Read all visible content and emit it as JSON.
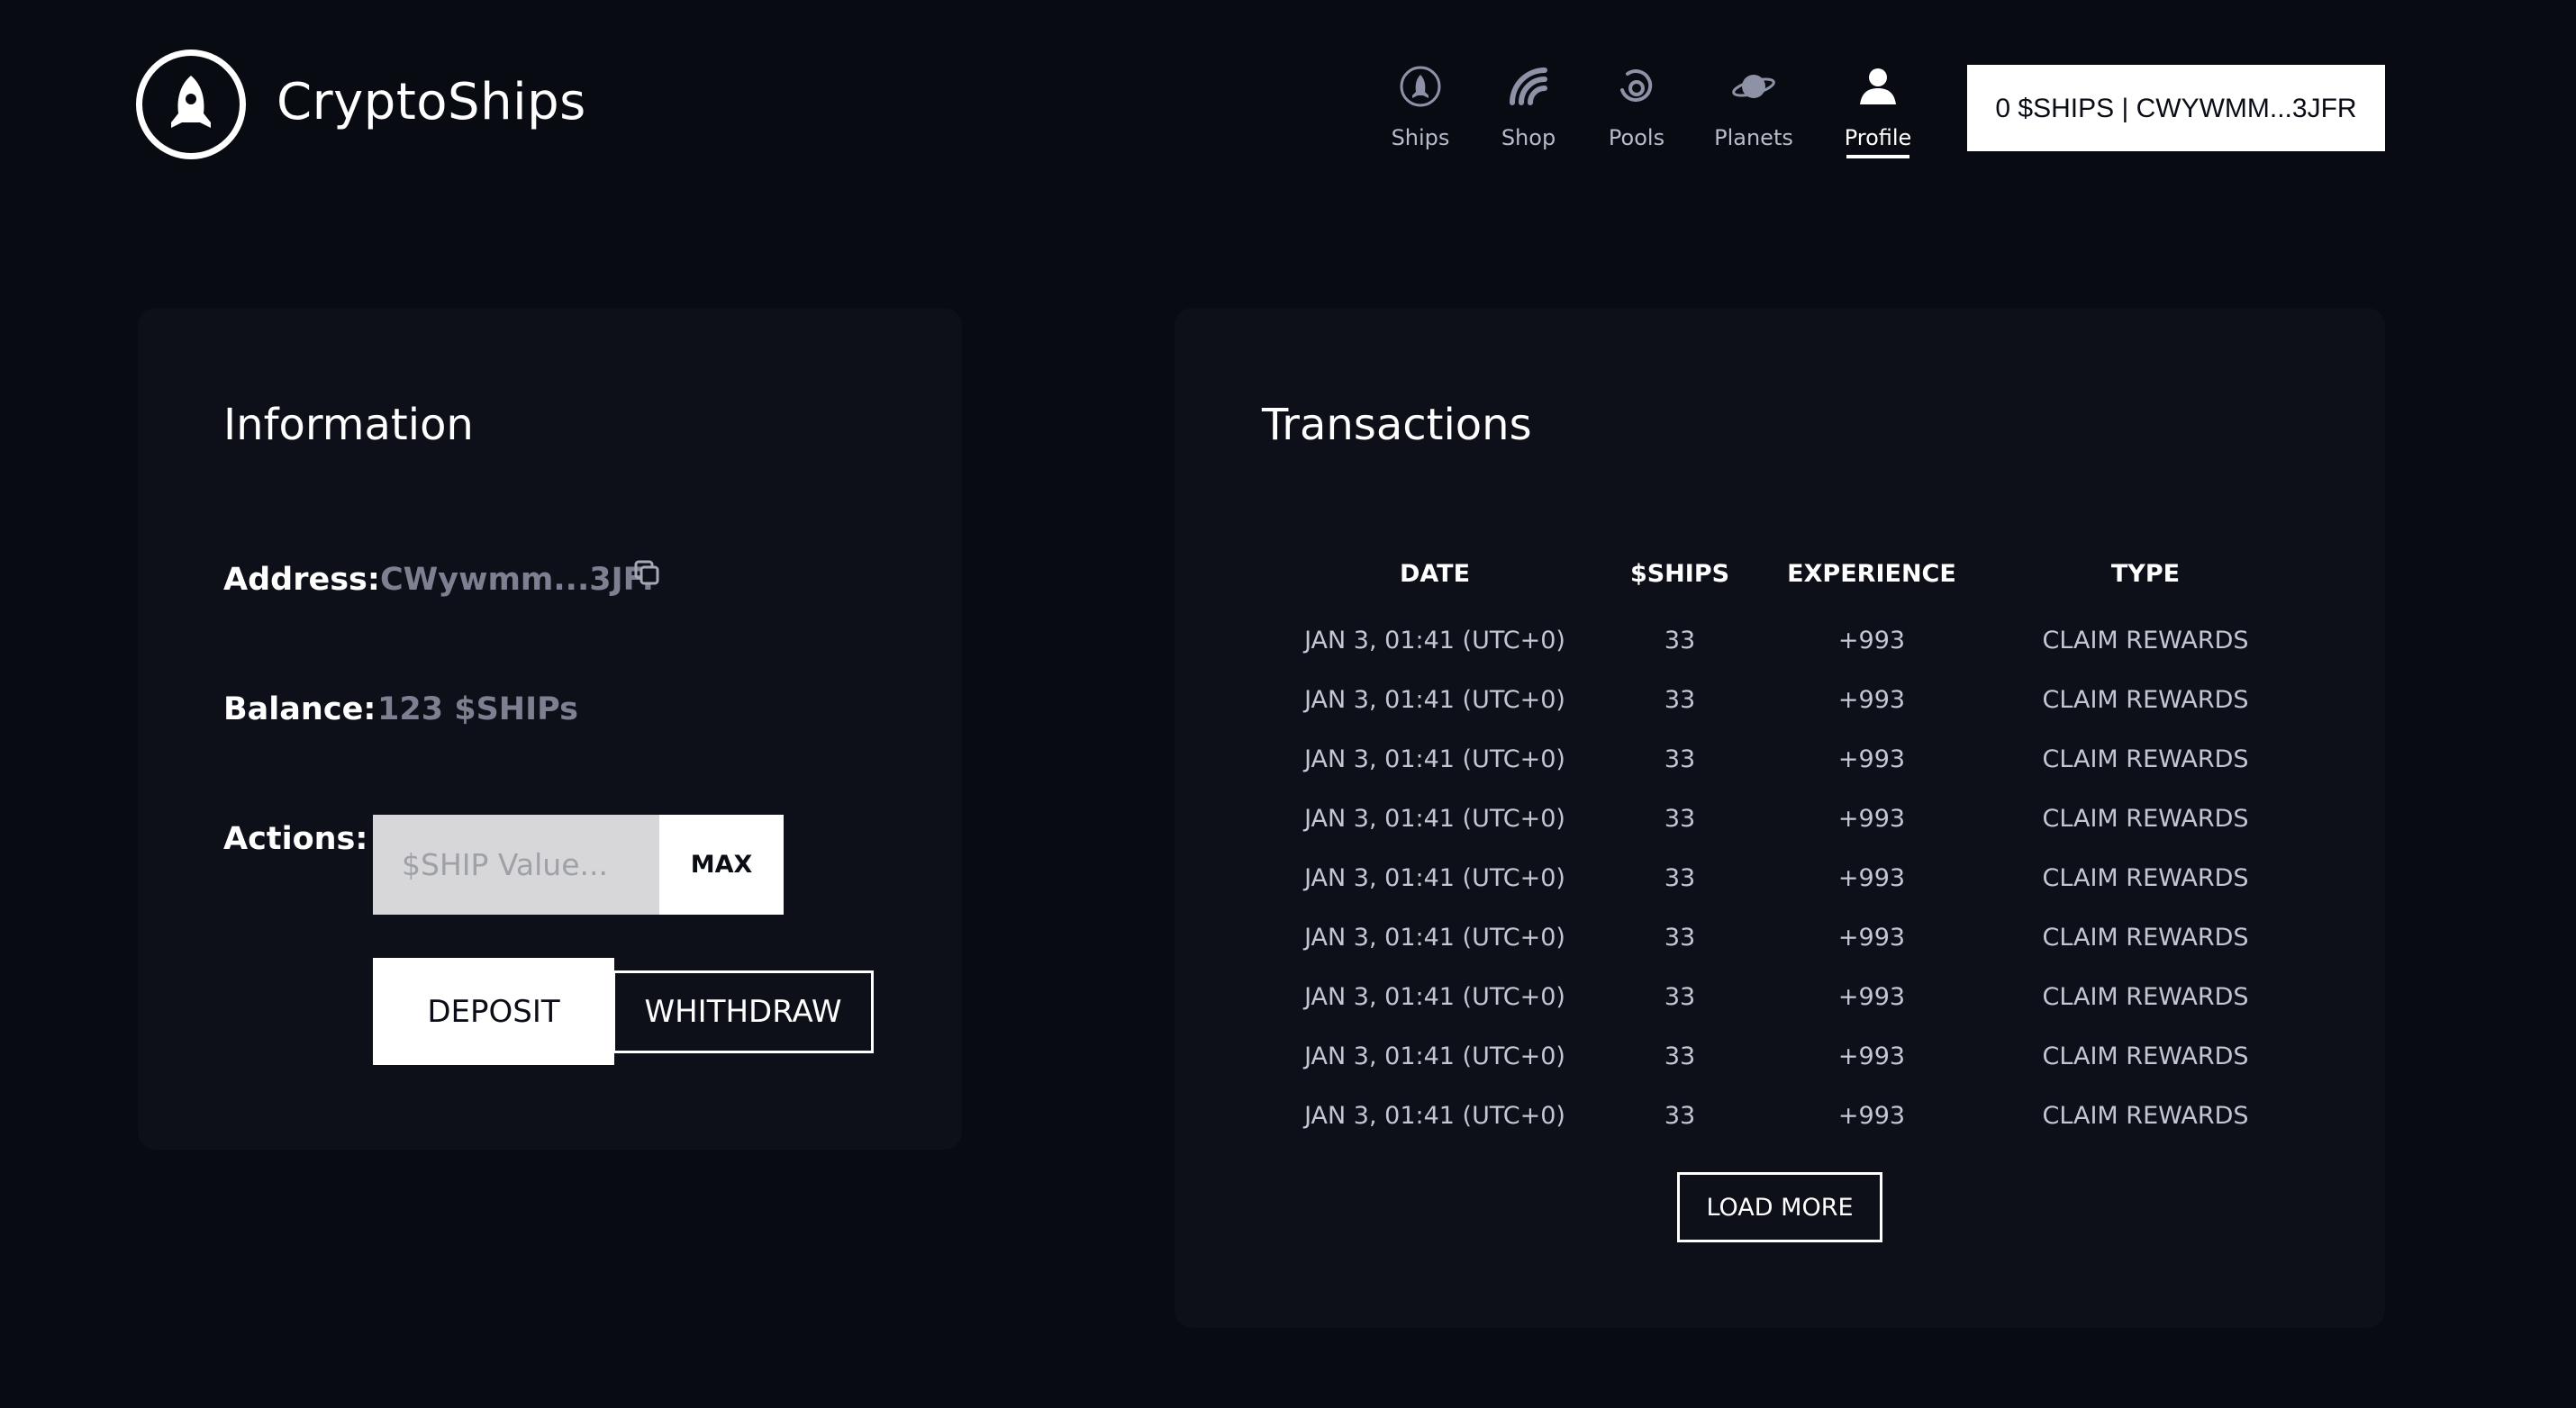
{
  "header": {
    "brand": "CryptoShips",
    "nav": [
      {
        "label": "Ships",
        "icon": "rocket-circle-icon"
      },
      {
        "label": "Shop",
        "icon": "signal-icon"
      },
      {
        "label": "Pools",
        "icon": "pool-icon"
      },
      {
        "label": "Planets",
        "icon": "planet-icon"
      },
      {
        "label": "Profile",
        "icon": "user-icon",
        "active": true
      }
    ],
    "wallet_label": "0 $SHIPS | CWYWMM...3JFR"
  },
  "info": {
    "title": "Information",
    "address_label": "Address:",
    "address_value": "CWywmm...3JFr",
    "balance_label": "Balance:",
    "balance_value": "123 $SHIPs",
    "actions_label": "Actions:",
    "input_placeholder": "$SHIP Value...",
    "max_label": "MAX",
    "deposit_label": "DEPOSIT",
    "withdraw_label": "WHITHDRAW"
  },
  "transactions": {
    "title": "Transactions",
    "columns": [
      "DATE",
      "$SHIPS",
      "EXPERIENCE",
      "TYPE"
    ],
    "rows": [
      [
        "JAN 3, 01:41 (UTC+0)",
        "33",
        "+993",
        "CLAIM REWARDS"
      ],
      [
        "JAN 3, 01:41 (UTC+0)",
        "33",
        "+993",
        "CLAIM REWARDS"
      ],
      [
        "JAN 3, 01:41 (UTC+0)",
        "33",
        "+993",
        "CLAIM REWARDS"
      ],
      [
        "JAN 3, 01:41 (UTC+0)",
        "33",
        "+993",
        "CLAIM REWARDS"
      ],
      [
        "JAN 3, 01:41 (UTC+0)",
        "33",
        "+993",
        "CLAIM REWARDS"
      ],
      [
        "JAN 3, 01:41 (UTC+0)",
        "33",
        "+993",
        "CLAIM REWARDS"
      ],
      [
        "JAN 3, 01:41 (UTC+0)",
        "33",
        "+993",
        "CLAIM REWARDS"
      ],
      [
        "JAN 3, 01:41 (UTC+0)",
        "33",
        "+993",
        "CLAIM REWARDS"
      ],
      [
        "JAN 3, 01:41 (UTC+0)",
        "33",
        "+993",
        "CLAIM REWARDS"
      ]
    ],
    "load_more_label": "LOAD MORE"
  }
}
